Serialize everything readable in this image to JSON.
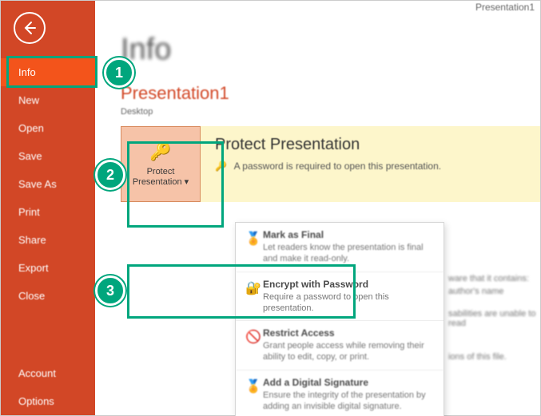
{
  "window": {
    "title": "Presentation1"
  },
  "sidebar": {
    "items": [
      "Info",
      "New",
      "Open",
      "Save",
      "Save As",
      "Print",
      "Share",
      "Export",
      "Close"
    ],
    "footer": [
      "Account",
      "Options"
    ],
    "activeIndex": 0
  },
  "page": {
    "title": "Info",
    "doc_title": "Presentation1",
    "doc_path": "Desktop"
  },
  "protect": {
    "button_label_line1": "Protect",
    "button_label_line2": "Presentation",
    "button_dropdown_glyph": "▾",
    "heading": "Protect Presentation",
    "desc": "A password is required to open this presentation."
  },
  "dropdown": {
    "items": [
      {
        "title": "Mark as Final",
        "desc": "Let readers know the presentation is final and make it read-only."
      },
      {
        "title": "Encrypt with Password",
        "desc": "Require a password to open this presentation."
      },
      {
        "title": "Restrict Access",
        "desc": "Grant people access while removing their ability to edit, copy, or print."
      },
      {
        "title": "Add a Digital Signature",
        "desc": "Ensure the integrity of the presentation by adding an invisible digital signature."
      }
    ]
  },
  "bg_info": {
    "line1": "ware that it contains:",
    "line2": "author's name",
    "line3": "sabilities are unable to read",
    "line4": "ions of this file."
  },
  "steps": {
    "one": "1",
    "two": "2",
    "three": "3"
  }
}
